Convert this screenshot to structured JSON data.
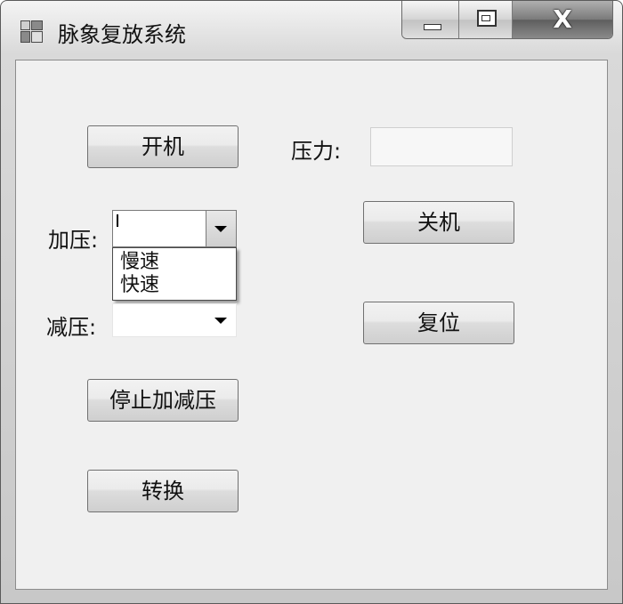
{
  "window": {
    "title": "脉象复放系统",
    "controls": {
      "minimize": "minimize-icon",
      "maximize": "maximize-icon",
      "close_glyph": "X"
    }
  },
  "buttons": {
    "power_on": "开机",
    "power_off": "关机",
    "reset": "复位",
    "stop_pressure": "停止加减压",
    "switch": "转换"
  },
  "labels": {
    "pressure": "压力:",
    "pressurize": "加压:",
    "depressurize": "减压:"
  },
  "pressure_field": {
    "value": ""
  },
  "pressurize_combo": {
    "value": "",
    "expanded": true,
    "options": [
      "慢速",
      "快速"
    ]
  },
  "depressurize_combo": {
    "value": ""
  },
  "colors": {
    "client_bg": "#f0f0f0",
    "button_face": "#e6e6e6",
    "border": "#707070"
  }
}
